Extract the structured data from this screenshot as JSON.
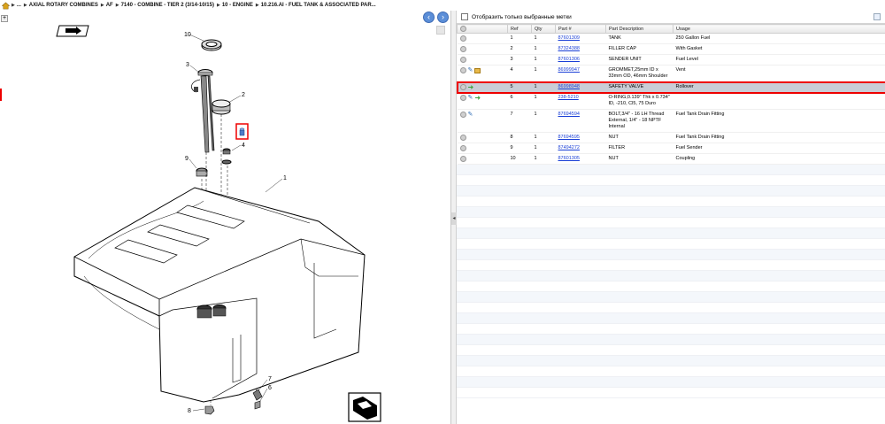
{
  "breadcrumb": {
    "items": [
      "...",
      "AXIAL ROTARY COMBINES",
      "AF",
      "7140 - COMBINE - TIER 2 (3/14-10/15)",
      "10 - ENGINE",
      "10.216.AI - FUEL TANK & ASSOCIATED PAR..."
    ]
  },
  "diagram": {
    "callouts": [
      "10",
      "3",
      "2",
      "4",
      "9",
      "1",
      "7",
      "6",
      "8"
    ]
  },
  "filter": {
    "label": "Отобразить только выбранные метки"
  },
  "table": {
    "headers": [
      "",
      "Ref",
      "Qty",
      "Part #",
      "Part Description",
      "Usage"
    ],
    "rows": [
      {
        "ref": "1",
        "qty": "1",
        "part": "87601309",
        "desc": "TANK",
        "usage": "250 Gallon Fuel"
      },
      {
        "ref": "2",
        "qty": "1",
        "part": "87324388",
        "desc": "FILLER CAP",
        "usage": "With Gasket"
      },
      {
        "ref": "3",
        "qty": "1",
        "part": "87601306",
        "desc": "SENDER UNIT",
        "usage": "Fuel Level"
      },
      {
        "ref": "4",
        "qty": "1",
        "part": "86999947",
        "desc": "GROMMET,25mm ID x 33mm OD, 46mm Shoulder",
        "usage": "Vent"
      },
      {
        "ref": "5",
        "qty": "1",
        "part": "86998948",
        "desc": "SAFETY VALVE",
        "usage": "Rollover"
      },
      {
        "ref": "6",
        "qty": "1",
        "part": "238-5210",
        "desc": "O-RING,0.139\" Thk x 0.734\" ID, -210, Cl5, 75 Duro",
        "usage": ""
      },
      {
        "ref": "7",
        "qty": "1",
        "part": "87694594",
        "desc": "BOLT,3/4\" - 16 LH Thread External, 1/4\" - 18 NPTF Internal",
        "usage": "Fuel Tank Drain Fitting"
      },
      {
        "ref": "8",
        "qty": "1",
        "part": "87694595",
        "desc": "NUT",
        "usage": "Fuel Tank Drain Fitting"
      },
      {
        "ref": "9",
        "qty": "1",
        "part": "87494272",
        "desc": "FILTER",
        "usage": "Fuel Sender"
      },
      {
        "ref": "10",
        "qty": "1",
        "part": "87601305",
        "desc": "NUT",
        "usage": "Coupling"
      }
    ]
  }
}
